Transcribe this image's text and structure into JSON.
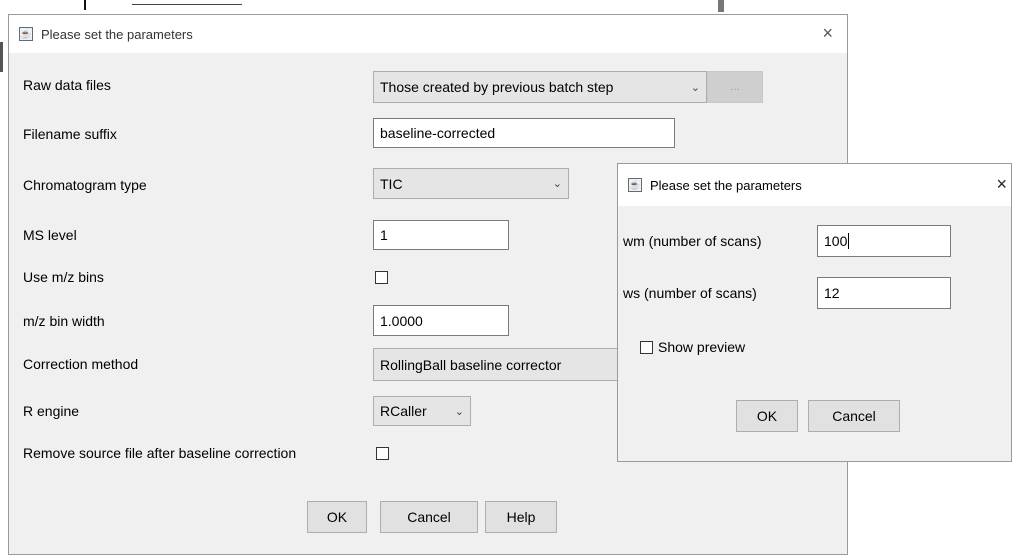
{
  "main_dialog": {
    "title": "Please set the parameters",
    "close_glyph": "×",
    "icon": "java-icon",
    "fields": {
      "raw_data_files": {
        "label": "Raw data files",
        "value": "Those created by previous batch step",
        "browse_label": "..."
      },
      "filename_suffix": {
        "label": "Filename suffix",
        "value": "baseline-corrected"
      },
      "chromatogram_type": {
        "label": "Chromatogram type",
        "value": "TIC"
      },
      "ms_level": {
        "label": "MS level",
        "value": "1"
      },
      "use_mz_bins": {
        "label": "Use m/z bins",
        "checked": false
      },
      "mz_bin_width": {
        "label": "m/z bin width",
        "value": "1.0000"
      },
      "correction_method": {
        "label": "Correction method",
        "value": "RollingBall baseline corrector"
      },
      "r_engine": {
        "label": "R engine",
        "value": "RCaller"
      },
      "remove_source": {
        "label": "Remove source file after baseline correction",
        "checked": false
      }
    },
    "buttons": {
      "ok": "OK",
      "cancel": "Cancel",
      "help": "Help"
    }
  },
  "sub_dialog": {
    "title": "Please set the parameters",
    "close_glyph": "×",
    "icon": "java-icon",
    "fields": {
      "wm": {
        "label": "wm (number of scans)",
        "value": "100"
      },
      "ws": {
        "label": "ws (number of scans)",
        "value": "12"
      },
      "show_preview": {
        "label": "Show preview",
        "checked": false
      }
    },
    "buttons": {
      "ok": "OK",
      "cancel": "Cancel"
    }
  },
  "colors": {
    "dialog_bg": "#f0f0f0",
    "titlebar_bg": "#ffffff",
    "button_bg": "#e1e1e1",
    "combo_bg": "#e5e5e5"
  }
}
